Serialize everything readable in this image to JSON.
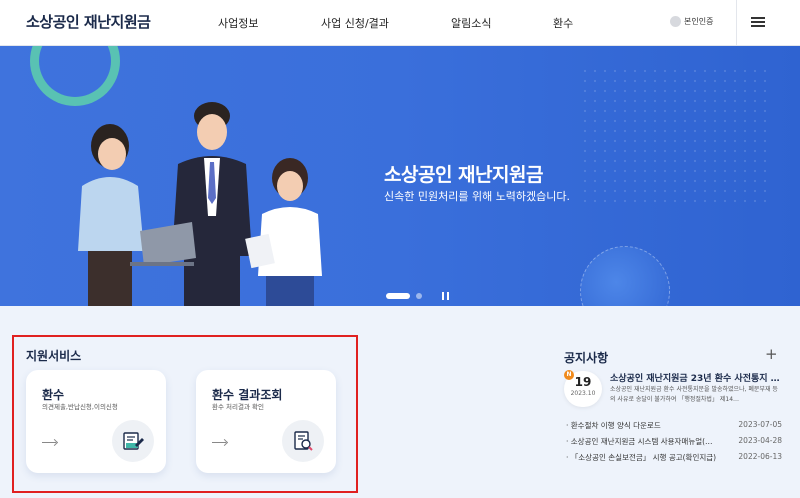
{
  "header": {
    "logo": "소상공인 재난지원금",
    "nav": [
      "사업정보",
      "사업 신청/결과",
      "알림소식",
      "환수"
    ],
    "auth_label": "본인인증",
    "menu_icon": "hamburger-icon"
  },
  "banner": {
    "title": "소상공인 재난지원금",
    "subtitle": "신속한 민원처리를 위해 노력하겠습니다."
  },
  "support": {
    "title": "지원서비스",
    "cards": [
      {
        "title": "환수",
        "desc": "의견제출,반납신청,이의신청",
        "icon": "document-edit-icon"
      },
      {
        "title": "환수 결과조회",
        "desc": "환수 처리결과 확인",
        "icon": "document-search-icon"
      }
    ]
  },
  "notice": {
    "title": "공지사항",
    "featured": {
      "badge": "N",
      "day": "19",
      "year_month": "2023.10",
      "title": "소상공인 재난지원금 23년 환수 사전통지 …",
      "body": "소상공인 재난지원금 환수 사전통지문을 발송하였으나, 폐문부재 등의 사유로 송달이 불가하여 「행정절차법」 제14…"
    },
    "items": [
      {
        "title": "환수절차 이행 양식 다운로드",
        "date": "2023-07-05"
      },
      {
        "title": "소상공인 재난지원금 시스템 사용자매뉴얼(…",
        "date": "2023-04-28"
      },
      {
        "title": "「소상공인 손실보전금」 시행 공고(확인지급)",
        "date": "2022-06-13"
      }
    ]
  },
  "colors": {
    "banner_blue": "#3a6fdb",
    "highlight_border": "#e02020",
    "new_badge": "#f08a1c"
  }
}
